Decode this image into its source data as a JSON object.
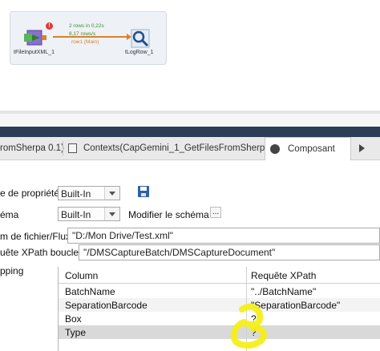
{
  "canvas": {
    "component_input_label": "tFileInputXML_1",
    "component_output_label": "tLogRow_1",
    "flow_rows_text": "2 rows in 0,22s",
    "flow_rate_text": "8,17 rows/s",
    "flow_name": "row1 (Main)",
    "colors": {
      "flow_green": "#3a8f3a",
      "flow_orange": "#d8822a",
      "error_red": "#e53935"
    }
  },
  "tabs": [
    {
      "label": "romSherpa 0.1)"
    },
    {
      "label": "Contexts(CapGemini_1_GetFilesFromSherpa)"
    },
    {
      "label": "Composant"
    }
  ],
  "form": {
    "property_type_label": "e de propriété",
    "property_type_value": "Built-In",
    "schema_label": "éma",
    "schema_value": "Built-In",
    "edit_schema_label": "Modifier le schéma",
    "edit_schema_button": "...",
    "file_name_label": "m de fichier/Flux",
    "file_name_value": "\"D:/Mon Drive/Test.xml\"",
    "xpath_loop_label": "uête XPath boucle",
    "xpath_loop_value": "\"/DMSCaptureBatch/DMSCaptureDocument\"",
    "mapping_label": "pping"
  },
  "mapping_table": {
    "headers": {
      "column": "Column",
      "xpath": "Requête XPath"
    },
    "rows": [
      {
        "column": "BatchName",
        "xpath": "\"../BatchName\""
      },
      {
        "column": "SeparationBarcode",
        "xpath": "\"SeparationBarcode\""
      },
      {
        "column": "Box",
        "xpath": "?"
      },
      {
        "column": "Type",
        "xpath": "?"
      }
    ]
  },
  "annotation_color": "#f5ee1a"
}
